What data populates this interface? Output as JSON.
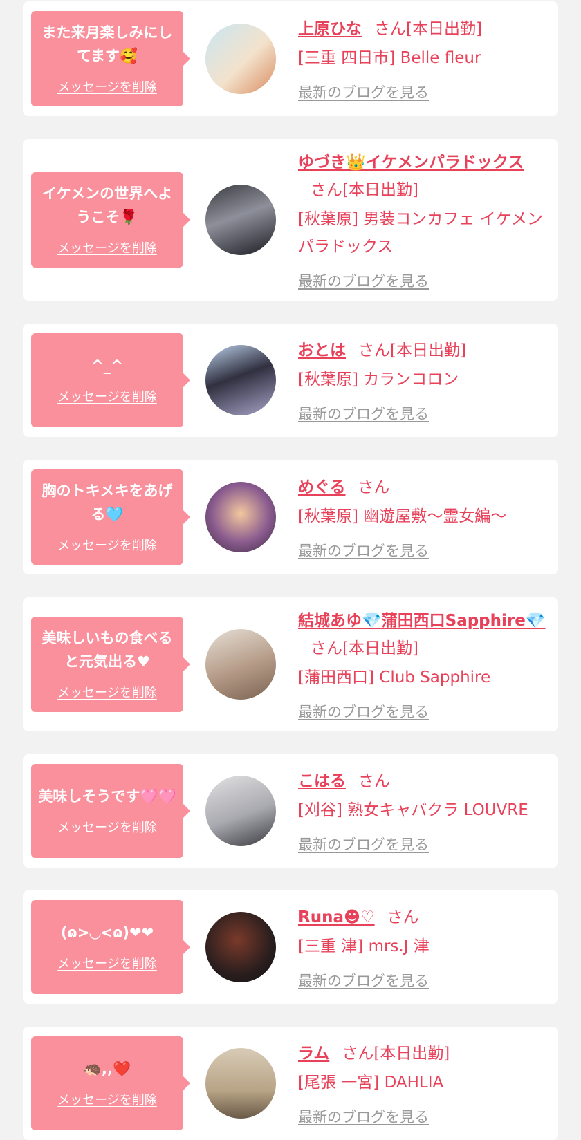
{
  "delete_label": "メッセージを削除",
  "blog_label": "最新のブログを見る",
  "colors": {
    "accent": "#e8425a",
    "bubble": "#f9909c",
    "card": "#ffffff",
    "background": "#f2f2f2",
    "muted": "#999999"
  },
  "cards": [
    {
      "message": "また来月楽しみにしてます🥰",
      "name": "上原ひな",
      "suffix": "さん[本日出勤]",
      "shop": "[三重 四日市] Belle fleur",
      "avatar_bg": "linear-gradient(135deg,#c9e6f2,#f3e2cc 55%,#d98b5f)"
    },
    {
      "message": "イケメンの世界へようこそ🌹",
      "name": "ゆづき👑イケメンパラドックス",
      "suffix": "さん[本日出勤]",
      "shop": "[秋葉原] 男装コンカフェ イケメンパラドックス",
      "avatar_bg": "linear-gradient(160deg,#3a3a3f,#8d8f9a 45%,#1c1c22)"
    },
    {
      "message": "^_^",
      "name": "おとは",
      "suffix": "さん[本日出勤]",
      "shop": "[秋葉原] カランコロン",
      "avatar_bg": "linear-gradient(160deg,#bcd0ea,#303040 45%,#a8a4c8)"
    },
    {
      "message": "胸のトキメキをあげる🩵",
      "name": "めぐる",
      "suffix": "さん",
      "shop": "[秋葉原] 幽遊屋敷〜霊女編〜",
      "avatar_bg": "radial-gradient(circle at 50% 45%,#f3c89e,#8a5b8f 55%,#3a2a3d)"
    },
    {
      "message": "美味しいもの食べると元気出る♥",
      "name": "結城あゆ💎蒲田西口Sapphire💎",
      "suffix": "さん[本日出勤]",
      "shop": "[蒲田西口] Club Sapphire",
      "avatar_bg": "linear-gradient(160deg,#e6dfd6,#b49a86 55%,#7a6352)"
    },
    {
      "message": "美味しそうです🩷🩷",
      "name": "こはる",
      "suffix": "さん",
      "shop": "[刈谷] 熟女キャバクラ LOUVRE",
      "avatar_bg": "linear-gradient(160deg,#e2e2e2,#a9a9b0 55%,#3a3a40)"
    },
    {
      "message": "(ɷ>◡<ɷ)❤❤",
      "name": "Runa☻♡",
      "suffix": "さん",
      "shop": "[三重 津] mrs.J 津",
      "avatar_bg": "radial-gradient(circle at 45% 40%,#7a3a2a,#2a1e1e 60%,#111)"
    },
    {
      "message": "🦔,,❤️",
      "name": "ラム",
      "suffix": "さん[本日出勤]",
      "shop": "[尾張 一宮] DAHLIA",
      "avatar_bg": "linear-gradient(180deg,#d8cbb6,#b8a486 60%,#6a5a48)"
    }
  ]
}
